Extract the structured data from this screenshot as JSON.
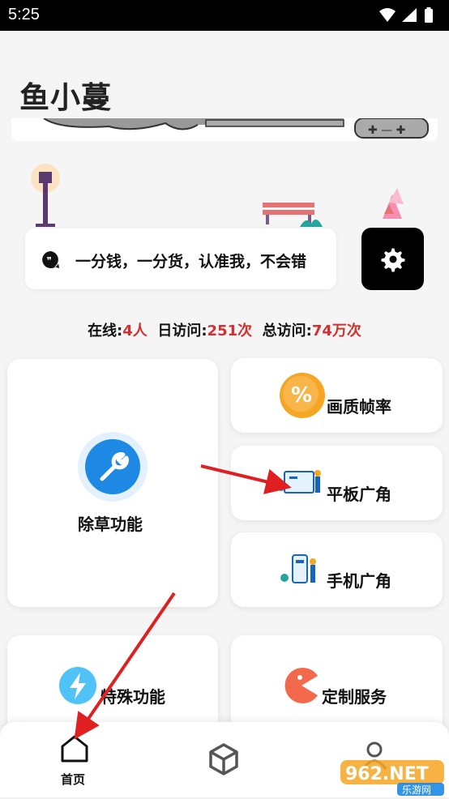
{
  "status": {
    "time": "5:25"
  },
  "app": {
    "title": "鱼小蔓"
  },
  "notice": {
    "text": "一分钱，一分货，认准我，不会错"
  },
  "stats": {
    "online_label": "在线:",
    "online_value": "4人",
    "daily_label": "日访问:",
    "daily_value": "251次",
    "total_label": "总访问:",
    "total_value": "74万次"
  },
  "cards": {
    "weed": "除草功能",
    "quality": "画质帧率",
    "tablet": "平板广角",
    "phone": "手机广角",
    "special": "特殊功能",
    "custom": "定制服务"
  },
  "nav": {
    "home": "首页"
  },
  "watermark": {
    "text": "962.NET",
    "sub": "乐游网"
  },
  "colors": {
    "accent_red": "#d32f2f",
    "blue": "#2196f3",
    "orange": "#f5a623",
    "coral": "#f26a4b"
  }
}
